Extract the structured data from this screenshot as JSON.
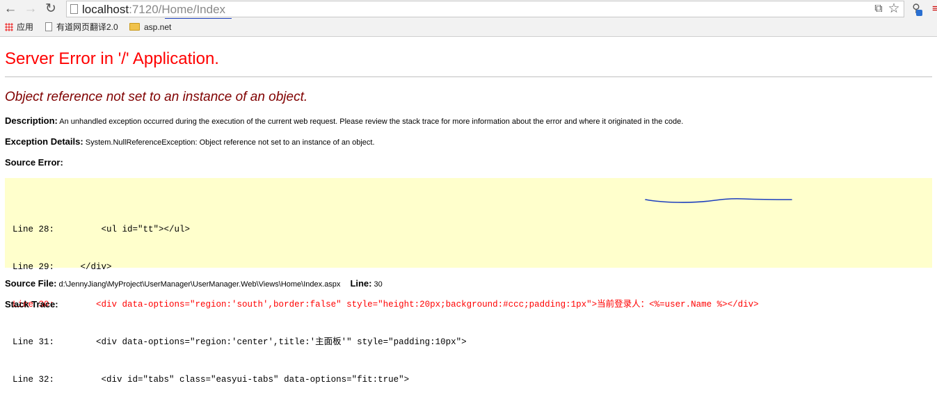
{
  "browser": {
    "url_host": "localhost",
    "url_port": ":7120",
    "url_path": "/Home/Index",
    "bookmarks": [
      "应用",
      "有道网页翻译2.0",
      "asp.net"
    ],
    "icons": [
      "back-arrow-icon",
      "forward-arrow-icon",
      "reload-icon",
      "page-icon",
      "translate-icon",
      "star-icon",
      "extension-icon",
      "menu-icon"
    ]
  },
  "error": {
    "title": "Server Error in '/' Application.",
    "subtitle": "Object reference not set to an instance of an object.",
    "description_label": "Description:",
    "description_text": " An unhandled exception occurred during the execution of the current web request. Please review the stack trace for more information about the error and where it originated in the code.",
    "exception_label": "Exception Details:",
    "exception_text": " System.NullReferenceException: Object reference not set to an instance of an object.",
    "source_error_label": "Source Error:",
    "code_lines": [
      "Line 28:         <ul id=\"tt\"></ul>",
      "Line 29:     </div>",
      "Line 30:        <div data-options=\"region:'south',border:false\" style=\"height:20px;background:#ccc;padding:1px\">当前登录人：<%=user.Name %></div>",
      "Line 31:        <div data-options=\"region:'center',title:'主面板'\" style=\"padding:10px\">",
      "Line 32:         <div id=\"tabs\" class=\"easyui-tabs\" data-options=\"fit:true\">"
    ],
    "highlighted_line": 30,
    "source_file_label": "Source File:",
    "source_file_path": " d:\\JennyJiang\\MyProject\\UserManager\\UserManager.Web\\Views\\Home\\Index.aspx",
    "line_label": "Line:",
    "line_number": " 30",
    "stack_trace_label": "Stack Trace:"
  },
  "colors": {
    "title": "#ff0000",
    "subtitle": "#800000",
    "code_background": "#ffffcc",
    "annotation_ink": "#1d3fbe"
  }
}
